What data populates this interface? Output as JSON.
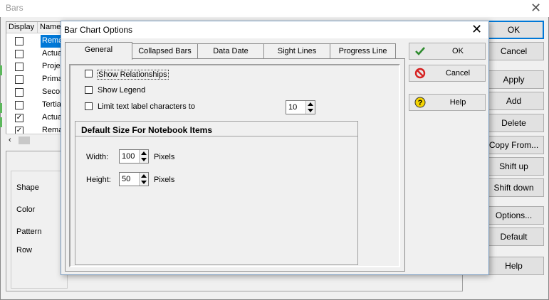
{
  "bars_window": {
    "title": "Bars",
    "grid_headers": [
      "Display",
      "Name"
    ],
    "rows": [
      {
        "checked": false,
        "name": "Remai",
        "selected": true
      },
      {
        "checked": false,
        "name": "Actua",
        "selected": false
      },
      {
        "checked": false,
        "name": "Projec",
        "selected": false
      },
      {
        "checked": false,
        "name": "Primar",
        "selected": false
      },
      {
        "checked": false,
        "name": "Secor",
        "selected": false
      },
      {
        "checked": false,
        "name": "Tertiar",
        "selected": false
      },
      {
        "checked": true,
        "name": "Actua",
        "selected": false
      },
      {
        "checked": true,
        "name": "Remai",
        "selected": false
      }
    ],
    "property_labels": [
      "Shape",
      "Color",
      "Pattern",
      "Row"
    ],
    "buttons": [
      "OK",
      "Cancel",
      "Apply",
      "Add",
      "Delete",
      "Copy From...",
      "Shift up",
      "Shift down",
      "Options...",
      "Default",
      "Help"
    ]
  },
  "dialog": {
    "title": "Bar Chart Options",
    "tabs": [
      "General",
      "Collapsed Bars",
      "Data Date",
      "Sight Lines",
      "Progress Line"
    ],
    "active_tab": "General",
    "options": {
      "show_relationships": "Show Relationships",
      "show_legend": "Show Legend",
      "limit_text": "Limit text label characters to",
      "limit_value": "10"
    },
    "group": {
      "title": "Default Size For Notebook Items",
      "width_label": "Width:",
      "width_value": "100",
      "height_label": "Height:",
      "height_value": "50",
      "unit": "Pixels"
    },
    "buttons": {
      "ok": "OK",
      "cancel": "Cancel",
      "help": "Help"
    }
  }
}
